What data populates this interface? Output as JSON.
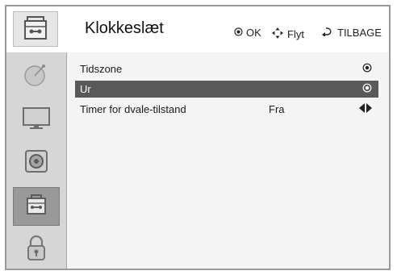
{
  "header": {
    "title": "Klokkeslæt",
    "hints": [
      {
        "icon": "ok-button-icon",
        "label": "OK"
      },
      {
        "icon": "move-arrows-icon",
        "label": "Flyt"
      },
      {
        "icon": "back-arrow-icon",
        "label": "TILBAGE"
      }
    ]
  },
  "sidebar": {
    "items": [
      {
        "icon": "satellite-dish-icon",
        "active": false
      },
      {
        "icon": "tv-monitor-icon",
        "active": false
      },
      {
        "icon": "speaker-icon",
        "active": false
      },
      {
        "icon": "briefcase-icon",
        "active": true
      },
      {
        "icon": "padlock-icon",
        "active": false
      }
    ]
  },
  "menu": {
    "rows": [
      {
        "label": "Tidszone",
        "value": "",
        "indicator": "radio-icon",
        "selected": false
      },
      {
        "label": "Ur",
        "value": "",
        "indicator": "radio-icon",
        "selected": true
      },
      {
        "label": "Timer for dvale-tilstand",
        "value": "Fra",
        "indicator": "left-right-arrows-icon",
        "selected": false
      }
    ]
  },
  "colors": {
    "selected_row": "#595959",
    "sidebar_bg": "#d6d6d6",
    "sidebar_active": "#999999",
    "panel_bg": "#f4f4f4"
  }
}
